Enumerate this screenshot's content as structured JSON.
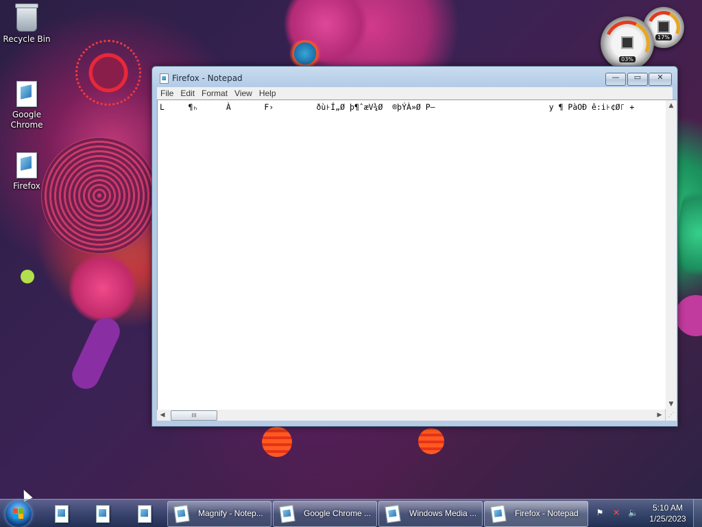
{
  "desktop": {
    "icons": [
      {
        "label": "Recycle Bin",
        "icon": "recycle-bin-icon"
      },
      {
        "label": "Google Chrome",
        "icon": "notepad-file-icon"
      },
      {
        "label": "Firefox",
        "icon": "notepad-file-icon"
      }
    ],
    "gadget": {
      "cpu_readout": "03%",
      "memory_readout": "17%"
    }
  },
  "window": {
    "title": "Firefox - Notepad",
    "menu": [
      "File",
      "Edit",
      "Format",
      "View",
      "Help"
    ],
    "content": "L     ¶ₕ      À       F›         ðù꜔Í„Ø þ¶ˆæV¾Ø  ®þÝÀ»Ø P–                        y ¶ PàOÐ ê:i꜔¢Ø꜒ +",
    "controls": {
      "minimize": "—",
      "maximize": "▭",
      "close": "✕"
    },
    "hscroll_thumb": "III"
  },
  "taskbar": {
    "pinned": [
      "notepad-icon",
      "notepad-icon",
      "notepad-icon"
    ],
    "tasks": [
      {
        "label": "Magnify - Notep..."
      },
      {
        "label": "Google Chrome ..."
      },
      {
        "label": "Windows Media ..."
      },
      {
        "label": "Firefox - Notepad"
      }
    ],
    "clock": {
      "time": "5:10 AM",
      "date": "1/25/2023"
    },
    "tray_icons": [
      "action-center-icon",
      "network-error-icon",
      "volume-icon"
    ]
  },
  "colors": {
    "window_frame": "#b7cce4",
    "taskbar": "#3c557d",
    "desktop_bg": "#2b1f45"
  }
}
